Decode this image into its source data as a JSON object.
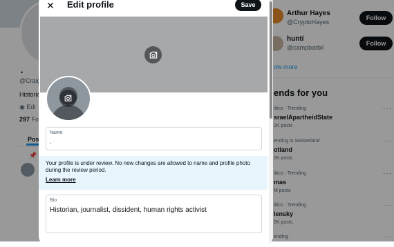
{
  "background": {
    "left": {
      "dot": "•",
      "handle": "@Craig",
      "bio": "Historia",
      "location": "Edi",
      "following_count": "297",
      "following_label": "Fol",
      "tab": "Pos"
    },
    "who_to_follow": [
      {
        "name": "Arthur Hayes",
        "handle": "@CryptoHayes",
        "follow_label": "Follow"
      },
      {
        "name": "huntí",
        "handle": "@campbarbil",
        "follow_label": "Follow"
      }
    ],
    "show_more": "ow more",
    "trends_title": "ends for you",
    "trends": [
      {
        "category": "litics · Trending",
        "name": "sraelApartheidState",
        "posts": "2K posts"
      },
      {
        "category": "ending in Switzerland",
        "name": "otland",
        "posts": "2K posts"
      },
      {
        "category": "litics · Trending",
        "name": "mas",
        "posts": "M posts"
      },
      {
        "category": "litics · Trending",
        "name": "lensky",
        "posts": "2K posts"
      },
      {
        "category": "ending",
        "name": "",
        "posts": ""
      }
    ]
  },
  "modal": {
    "title": "Edit profile",
    "save_label": "Save",
    "name_field": {
      "label": "Name",
      "value": "."
    },
    "review_notice": "Your profile is under review. No new changes are allowed to name and profile photo during the review period.",
    "learn_more": "Learn more",
    "bio_field": {
      "label": "Bio",
      "value": "Historian, journalist, dissident, human rights activist"
    }
  },
  "colors": {
    "accent": "#1d9bf0",
    "overlay": "rgba(0,0,0,0.40)",
    "review_bg": "#e8f5fd"
  }
}
